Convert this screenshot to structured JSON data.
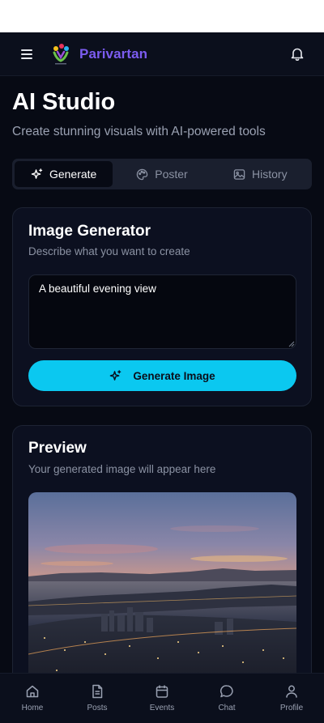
{
  "header": {
    "brand": "Parivartan",
    "icons": {
      "menu": "hamburger-menu-icon",
      "logo": "parivartan-logo",
      "notifications": "bell-icon"
    }
  },
  "page": {
    "title": "AI Studio",
    "subtitle": "Create stunning visuals with AI-powered tools"
  },
  "tabs": [
    {
      "label": "Generate",
      "icon": "sparkles-icon",
      "active": true
    },
    {
      "label": "Poster",
      "icon": "palette-icon",
      "active": false
    },
    {
      "label": "History",
      "icon": "image-icon",
      "active": false
    }
  ],
  "generator": {
    "title": "Image Generator",
    "subtitle": "Describe what you want to create",
    "prompt_value": "A beautiful evening view",
    "button_label": "Generate Image",
    "button_icon": "sparkles-icon"
  },
  "preview": {
    "title": "Preview",
    "subtitle": "Your generated image will appear here",
    "image": "generated-evening-cityscape-image"
  },
  "nav": [
    {
      "label": "Home",
      "icon": "home-icon"
    },
    {
      "label": "Posts",
      "icon": "document-icon"
    },
    {
      "label": "Events",
      "icon": "calendar-icon"
    },
    {
      "label": "Chat",
      "icon": "chat-bubble-icon"
    },
    {
      "label": "Profile",
      "icon": "user-icon"
    }
  ],
  "colors": {
    "background": "#070a14",
    "brand": "#7c5cf0",
    "accent": "#0bc8f0",
    "card": "#0c1020",
    "muted_text": "#8b92a3"
  }
}
